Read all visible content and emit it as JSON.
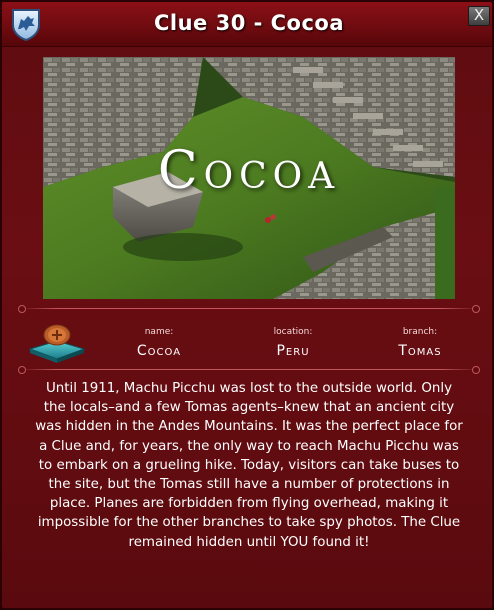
{
  "window": {
    "title": "Clue 30 - Cocoa",
    "close_label": "X"
  },
  "photo": {
    "caption": "Cocoa"
  },
  "info": {
    "name_label": "name:",
    "name_value": "Cocoa",
    "location_label": "location:",
    "location_value": "Peru",
    "branch_label": "branch:",
    "branch_value": "Tomas"
  },
  "description": "Until 1911, Machu Picchu was lost to the outside world. Only the locals–and a few Tomas agents–knew that an ancient city was hidden in the Andes Mountains. It was the perfect place for a Clue and, for years, the only way to reach Machu Picchu was to embark on a grueling hike. Today, visitors can take buses to the site, but the Tomas still have a number of protections in place. Planes are forbidden from flying overhead, making it impossible for the other branches to take spy photos. The Clue remained hidden until YOU found it!",
  "icons": {
    "logo": "wolf-crest-icon",
    "close": "close-icon",
    "clue": "clue-book-icon"
  },
  "colors": {
    "panel": "#5e0c10",
    "titlebar": "#8b1016",
    "divider": "#c4555b",
    "text": "#ffffff"
  }
}
